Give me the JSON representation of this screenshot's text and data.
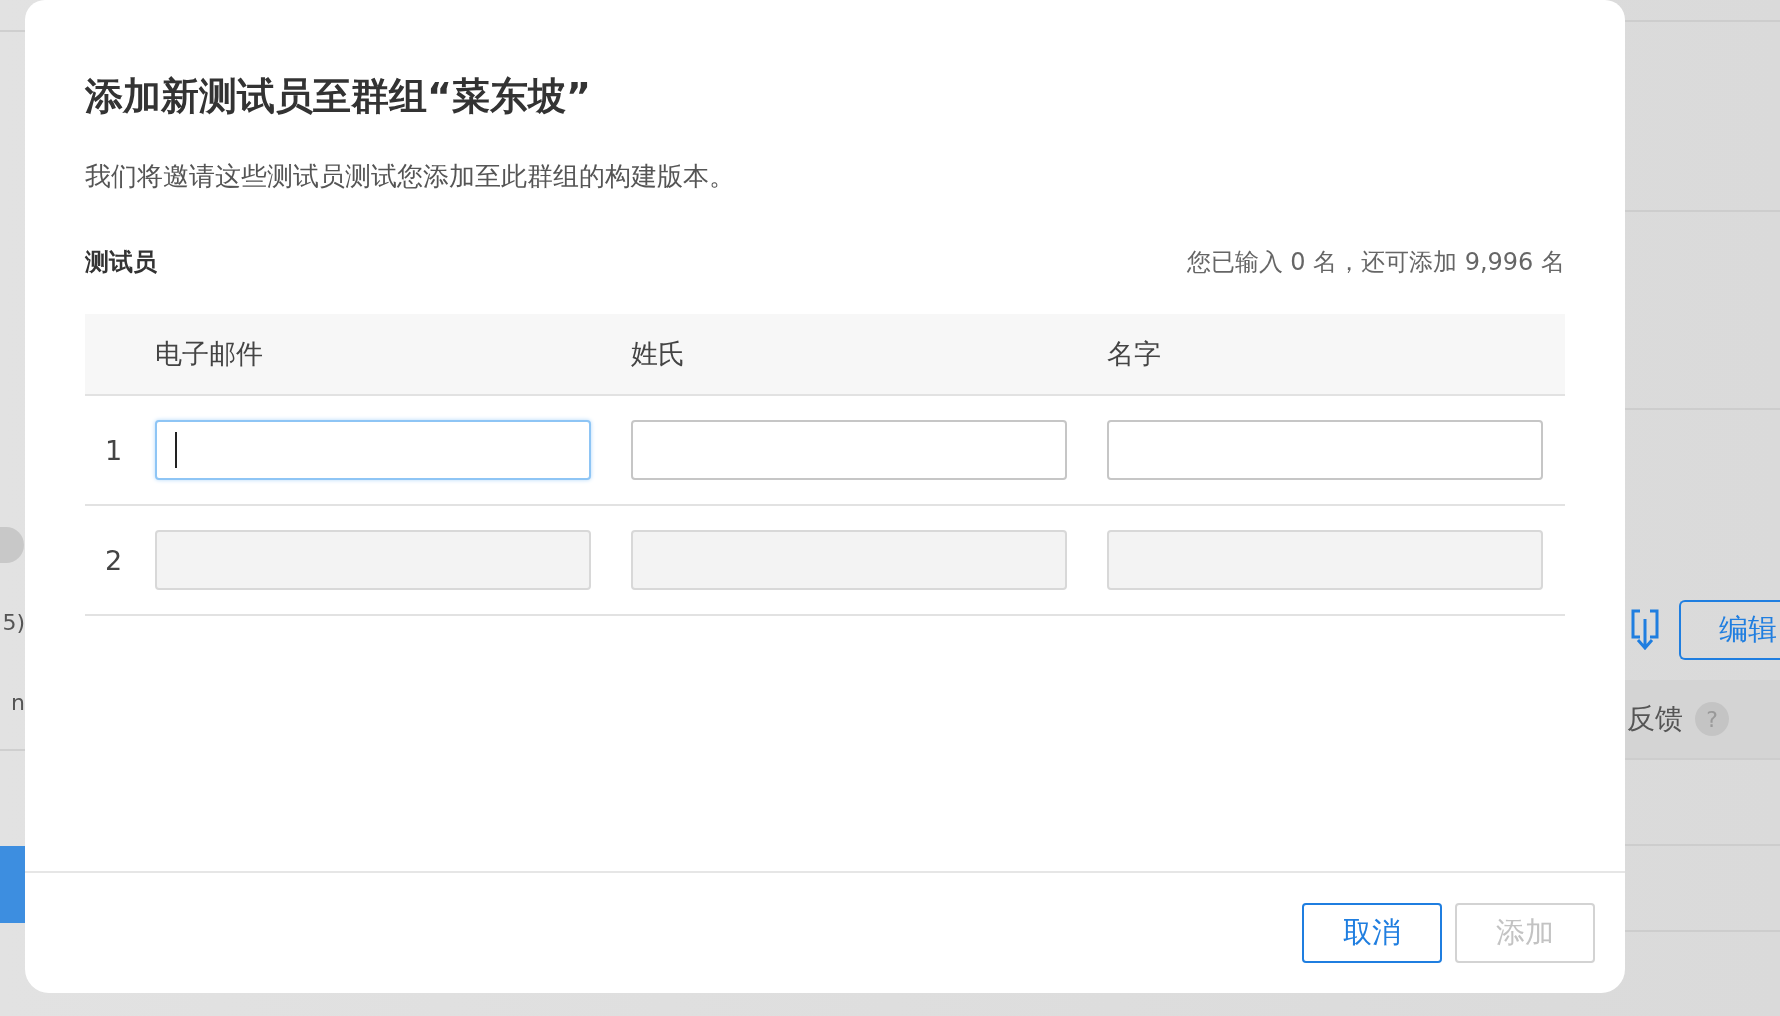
{
  "background": {
    "left_fragments": [
      "5)",
      "n"
    ],
    "edit_button": "编辑",
    "feedback_label": "反馈",
    "help_icon": "?"
  },
  "dialog": {
    "title": "添加新测试员至群组“菜东坡”",
    "description": "我们将邀请这些测试员测试您添加至此群组的构建版本。",
    "section_label": "测试员",
    "counter": "您已输入 0 名，还可添加 9,996 名",
    "columns": [
      "电子邮件",
      "姓氏",
      "名字"
    ],
    "rows": [
      {
        "number": "1",
        "disabled": false,
        "fields": [
          {
            "focused": true
          },
          {
            "focused": false
          },
          {
            "focused": false
          }
        ]
      },
      {
        "number": "2",
        "disabled": true,
        "fields": [
          {
            "focused": false
          },
          {
            "focused": false
          },
          {
            "focused": false
          }
        ]
      }
    ],
    "buttons": [
      {
        "label": "取消",
        "disabled": false
      },
      {
        "label": "添加",
        "disabled": true
      }
    ]
  }
}
